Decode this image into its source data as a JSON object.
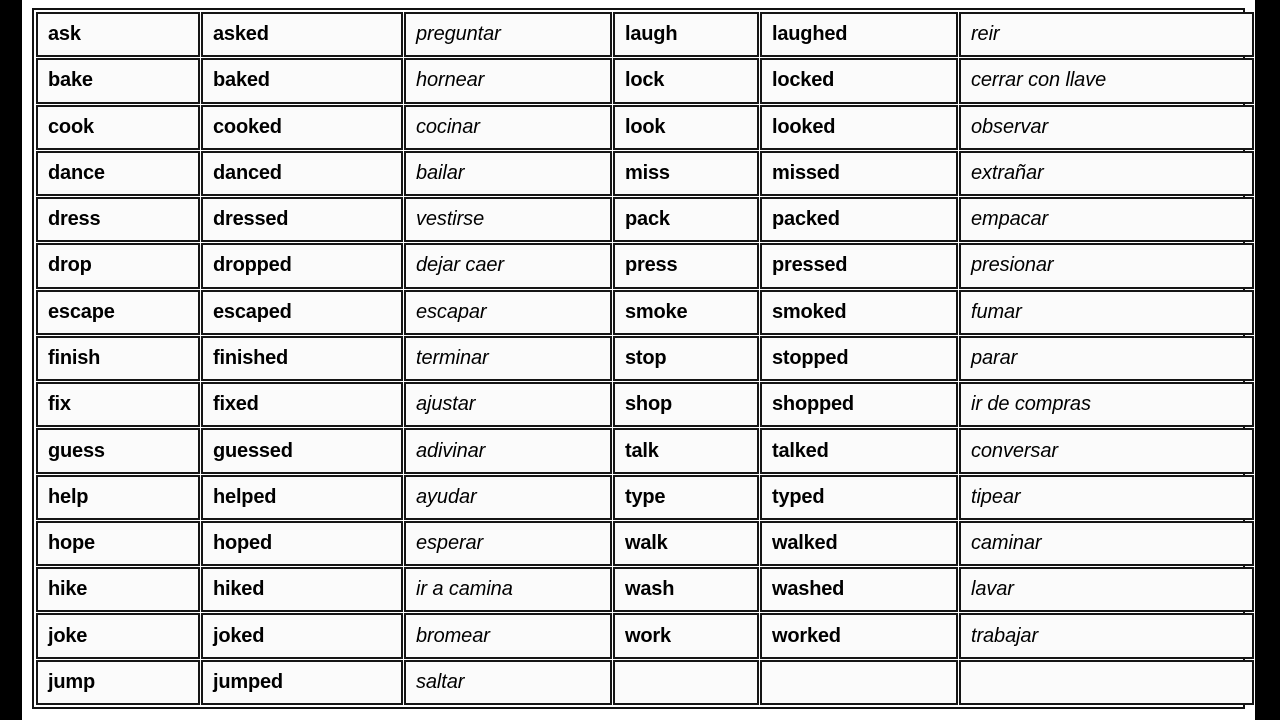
{
  "document": {
    "kind": "regular-verbs-table",
    "background_color": "#000000",
    "sheet_color": "#ffffff",
    "border_color": "#151515",
    "cell_color": "#fbfbfb",
    "text_color": "#000000"
  },
  "table": {
    "columns": 6,
    "rows": 15,
    "column_roles": [
      "english-base-left",
      "english-past-left",
      "spanish-left",
      "english-base-right",
      "english-past-right",
      "spanish-right"
    ],
    "rows_data": [
      {
        "base_l": "ask",
        "past_l": "asked",
        "es_l": "preguntar",
        "base_r": "laugh",
        "past_r": "laughed",
        "es_r": "reir"
      },
      {
        "base_l": "bake",
        "past_l": "baked",
        "es_l": "hornear",
        "base_r": "lock",
        "past_r": "locked",
        "es_r": "cerrar con llave"
      },
      {
        "base_l": "cook",
        "past_l": "cooked",
        "es_l": "cocinar",
        "base_r": "look",
        "past_r": "looked",
        "es_r": "observar"
      },
      {
        "base_l": "dance",
        "past_l": "danced",
        "es_l": "bailar",
        "base_r": "miss",
        "past_r": "missed",
        "es_r": "extrañar"
      },
      {
        "base_l": "dress",
        "past_l": "dressed",
        "es_l": "vestirse",
        "base_r": "pack",
        "past_r": "packed",
        "es_r": "empacar"
      },
      {
        "base_l": "drop",
        "past_l": "dropped",
        "es_l": "dejar caer",
        "base_r": "press",
        "past_r": "pressed",
        "es_r": "presionar"
      },
      {
        "base_l": "escape",
        "past_l": "escaped",
        "es_l": "escapar",
        "base_r": "smoke",
        "past_r": "smoked",
        "es_r": "fumar"
      },
      {
        "base_l": "finish",
        "past_l": "finished",
        "es_l": "terminar",
        "base_r": "stop",
        "past_r": "stopped",
        "es_r": "parar"
      },
      {
        "base_l": "fix",
        "past_l": "fixed",
        "es_l": "ajustar",
        "base_r": "shop",
        "past_r": "shopped",
        "es_r": "ir de compras"
      },
      {
        "base_l": "guess",
        "past_l": "guessed",
        "es_l": "adivinar",
        "base_r": "talk",
        "past_r": "talked",
        "es_r": "conversar"
      },
      {
        "base_l": "help",
        "past_l": "helped",
        "es_l": "ayudar",
        "base_r": "type",
        "past_r": "typed",
        "es_r": "tipear"
      },
      {
        "base_l": "hope",
        "past_l": "hoped",
        "es_l": "esperar",
        "base_r": "walk",
        "past_r": "walked",
        "es_r": "caminar"
      },
      {
        "base_l": "hike",
        "past_l": "hiked",
        "es_l": "ir a camina",
        "base_r": "wash",
        "past_r": "washed",
        "es_r": "lavar"
      },
      {
        "base_l": "joke",
        "past_l": "joked",
        "es_l": "bromear",
        "base_r": "work",
        "past_r": "worked",
        "es_r": "trabajar"
      },
      {
        "base_l": "jump",
        "past_l": "jumped",
        "es_l": "saltar",
        "base_r": "",
        "past_r": "",
        "es_r": ""
      }
    ]
  }
}
